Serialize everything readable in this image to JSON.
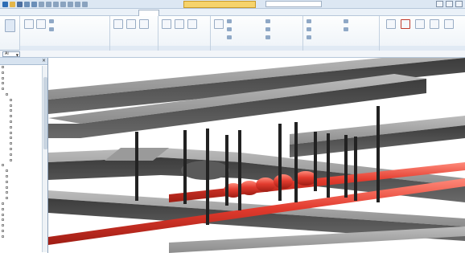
{
  "app": {
    "file_title": "",
    "search_placeholder": ""
  },
  "ribbon": {
    "tabs": [
      {
        "label": ""
      },
      {
        "label": ""
      },
      {
        "label": ""
      },
      {
        "label": ""
      },
      {
        "label": ""
      },
      {
        "label": ""
      },
      {
        "label": ""
      },
      {
        "label": ""
      },
      {
        "label": ""
      },
      {
        "label": ""
      },
      {
        "label": ""
      },
      {
        "label": ""
      },
      {
        "label": ""
      }
    ],
    "active_tab_index": 6,
    "groups": [
      {
        "label": "",
        "small_items": [
          "",
          ""
        ]
      },
      {
        "label": "",
        "small_items": [
          "",
          ""
        ]
      },
      {
        "label": "",
        "small_items": [
          "",
          "",
          ""
        ]
      },
      {
        "label": "",
        "small_items": [
          "",
          "",
          ""
        ]
      },
      {
        "label": "",
        "small_items": [
          "",
          "",
          ""
        ]
      },
      {
        "label": "",
        "small_items": []
      }
    ]
  },
  "properties_bar": {
    "type_value": "Ai"
  },
  "project_browser": {
    "title": "",
    "items": [
      {
        "label": "",
        "indent": 0,
        "red": false
      },
      {
        "label": "",
        "indent": 0,
        "red": false
      },
      {
        "label": "",
        "indent": 0,
        "red": false
      },
      {
        "label": "",
        "indent": 0,
        "red": false
      },
      {
        "label": "",
        "indent": 0,
        "red": false
      },
      {
        "label": "",
        "indent": 1,
        "red": false
      },
      {
        "label": "",
        "indent": 2,
        "red": false
      },
      {
        "label": "",
        "indent": 2,
        "red": false
      },
      {
        "label": "",
        "indent": 2,
        "red": false
      },
      {
        "label": "",
        "indent": 2,
        "red": false
      },
      {
        "label": "",
        "indent": 2,
        "red": false
      },
      {
        "label": "",
        "indent": 2,
        "red": false
      },
      {
        "label": "",
        "indent": 2,
        "red": true
      },
      {
        "label": "",
        "indent": 2,
        "red": false
      },
      {
        "label": "",
        "indent": 2,
        "red": false
      },
      {
        "label": "",
        "indent": 2,
        "red": false
      },
      {
        "label": "",
        "indent": 2,
        "red": false
      },
      {
        "label": "",
        "indent": 2,
        "red": false
      },
      {
        "label": "",
        "indent": 0,
        "red": false
      },
      {
        "label": "",
        "indent": 1,
        "red": false
      },
      {
        "label": "",
        "indent": 1,
        "red": false
      },
      {
        "label": "",
        "indent": 1,
        "red": false
      },
      {
        "label": "",
        "indent": 1,
        "red": false
      },
      {
        "label": "",
        "indent": 1,
        "red": false
      },
      {
        "label": "",
        "indent": 1,
        "red": false
      },
      {
        "label": "",
        "indent": 0,
        "red": false
      },
      {
        "label": "",
        "indent": 0,
        "red": false
      },
      {
        "label": "",
        "indent": 0,
        "red": false
      },
      {
        "label": "",
        "indent": 0,
        "red": false
      },
      {
        "label": "",
        "indent": 0,
        "red": false
      },
      {
        "label": "",
        "indent": 0,
        "red": false
      },
      {
        "label": "",
        "indent": 0,
        "red": false
      }
    ]
  },
  "colors": {
    "duct": "#8a8a8a",
    "duct_dark": "#4a4a4a",
    "pipe": "#e23b2e",
    "ribbon_bg": "#eef3f8",
    "filename_bg": "#f6d36b"
  }
}
